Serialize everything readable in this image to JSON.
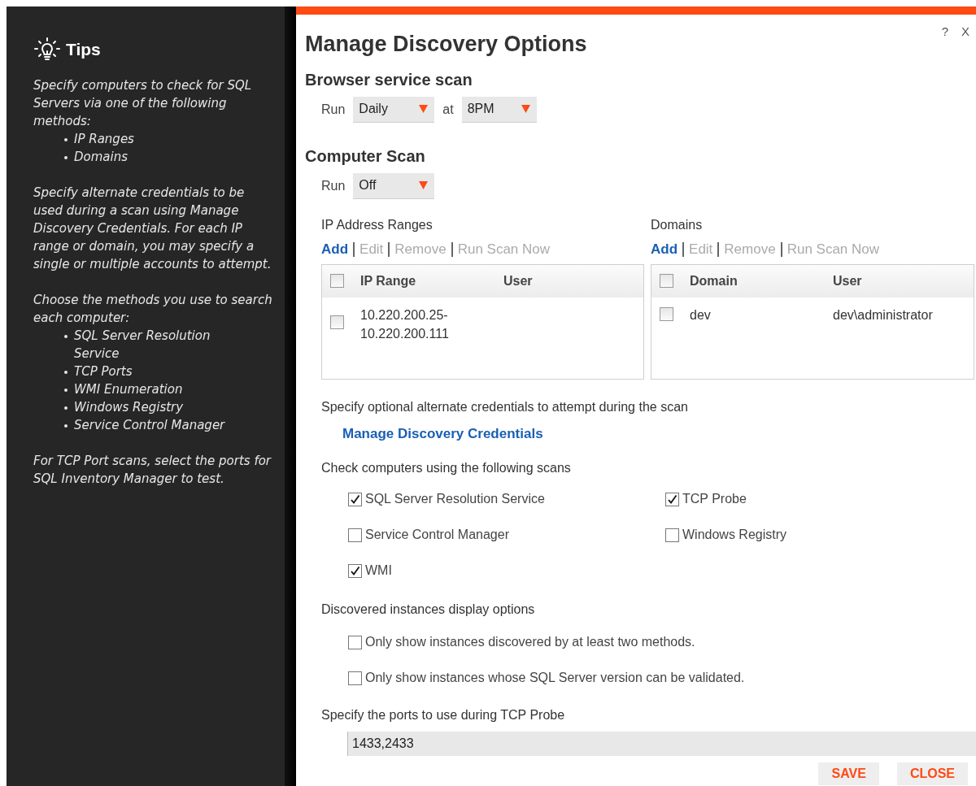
{
  "tips": {
    "title": "Tips",
    "blocks": [
      {
        "text": "Specify computers to check for SQL Servers via one of the following methods:",
        "bullets": [
          "IP Ranges",
          "Domains"
        ]
      },
      {
        "text": "Specify alternate credentials to be used during a scan using Manage Discovery Credentials. For each IP range or domain, you may specify a single or multiple accounts to attempt."
      },
      {
        "text": "Choose the methods you use to search each computer:",
        "bullets": [
          "SQL Server Resolution Service",
          "TCP Ports",
          "WMI Enumeration",
          "Windows Registry",
          "Service Control Manager"
        ]
      },
      {
        "text": "For TCP Port scans, select the ports for SQL Inventory Manager to test."
      }
    ]
  },
  "dialog": {
    "title": "Manage Discovery Options",
    "help": "?",
    "close": "X"
  },
  "browser_scan": {
    "heading": "Browser service scan",
    "run_label": "Run",
    "run_value": "Daily",
    "at_label": "at",
    "time_value": "8PM"
  },
  "computer_scan": {
    "heading": "Computer Scan",
    "run_label": "Run",
    "run_value": "Off"
  },
  "lists": [
    {
      "title": "IP Address Ranges",
      "actions": [
        {
          "label": "Add",
          "disabled": false
        },
        {
          "label": "Edit",
          "disabled": true
        },
        {
          "label": "Remove",
          "disabled": true
        },
        {
          "label": "Run Scan Now",
          "disabled": true
        }
      ],
      "columns": [
        "IP Range",
        "User"
      ],
      "all_checked": false,
      "rows": [
        {
          "checked": false,
          "cells": [
            "10.220.200.25-\n10.220.200.111",
            ""
          ]
        }
      ]
    },
    {
      "title": "Domains",
      "actions": [
        {
          "label": "Add",
          "disabled": false
        },
        {
          "label": "Edit",
          "disabled": true
        },
        {
          "label": "Remove",
          "disabled": true
        },
        {
          "label": "Run Scan Now",
          "disabled": true
        }
      ],
      "columns": [
        "Domain",
        "User"
      ],
      "all_checked": false,
      "rows": [
        {
          "checked": false,
          "cells": [
            "dev",
            "dev\\administrator"
          ]
        }
      ]
    }
  ],
  "credentials": {
    "text": "Specify optional alternate credentials to attempt during the scan",
    "link": "Manage Discovery Credentials"
  },
  "scans": {
    "heading": "Check computers using the following scans",
    "options": [
      {
        "label": "SQL Server Resolution Service",
        "checked": true
      },
      {
        "label": "TCP Probe",
        "checked": true
      },
      {
        "label": "Service Control Manager",
        "checked": false
      },
      {
        "label": "Windows Registry",
        "checked": false
      },
      {
        "label": "WMI",
        "checked": true
      }
    ]
  },
  "display": {
    "heading": "Discovered instances display options",
    "options": [
      {
        "label": "Only show instances discovered by at least two methods.",
        "checked": false
      },
      {
        "label": "Only show instances whose SQL Server version can be validated.",
        "checked": false
      }
    ]
  },
  "ports": {
    "heading": "Specify the ports to use during TCP Probe",
    "value": "1433,2433"
  },
  "buttons": [
    "SAVE",
    "CLOSE"
  ]
}
